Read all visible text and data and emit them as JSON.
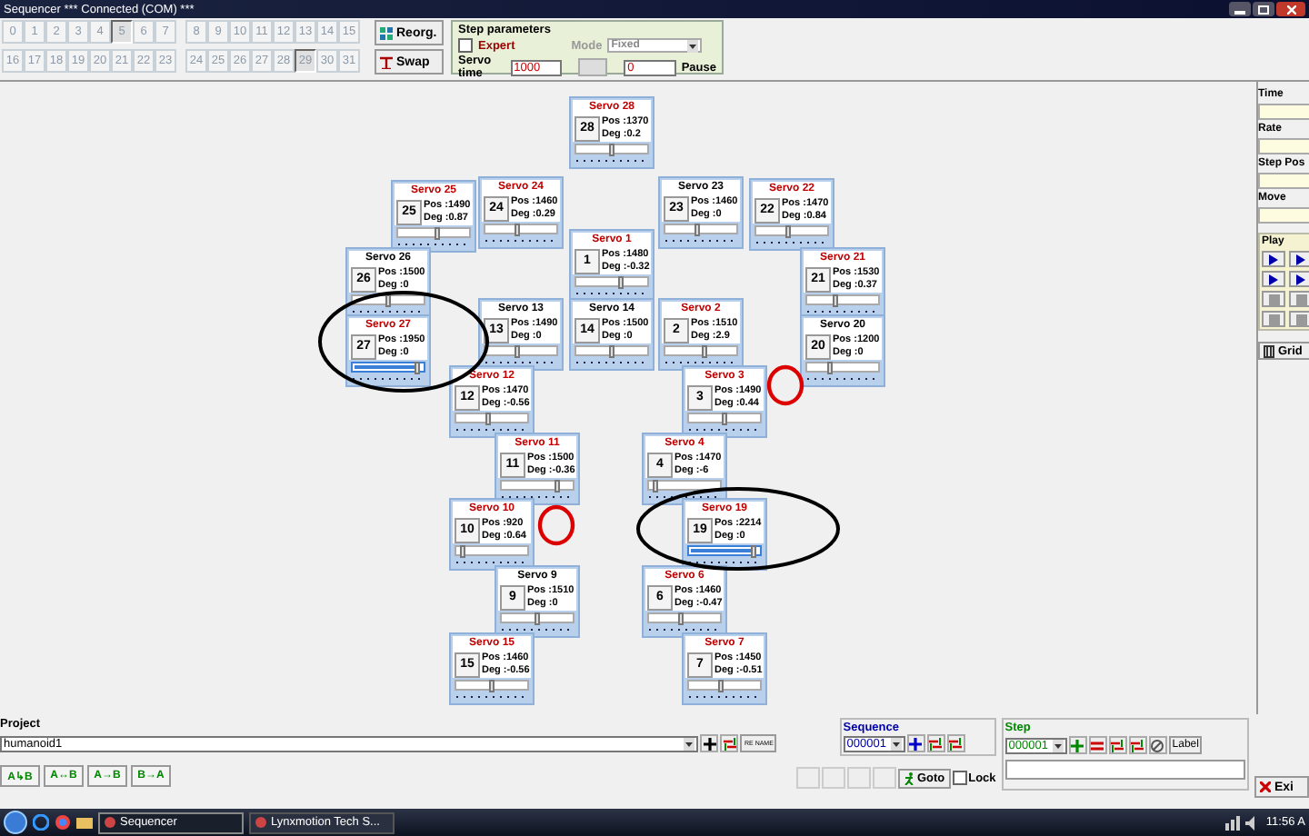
{
  "window": {
    "title": "Sequencer  *** Connected (COM) ***"
  },
  "step_buttons": [
    {
      "label": "0",
      "selected": false
    },
    {
      "label": "1",
      "selected": false
    },
    {
      "label": "2",
      "selected": false
    },
    {
      "label": "3",
      "selected": false
    },
    {
      "label": "4",
      "selected": false
    },
    {
      "label": "5",
      "selected": true
    },
    {
      "label": "6",
      "selected": false
    },
    {
      "label": "7",
      "selected": false
    },
    {
      "label": "8",
      "selected": false
    },
    {
      "label": "9",
      "selected": false
    },
    {
      "label": "10",
      "selected": false
    },
    {
      "label": "11",
      "selected": false
    },
    {
      "label": "12",
      "selected": false
    },
    {
      "label": "13",
      "selected": false
    },
    {
      "label": "14",
      "selected": false
    },
    {
      "label": "15",
      "selected": false
    },
    {
      "label": "16",
      "selected": false
    },
    {
      "label": "17",
      "selected": false
    },
    {
      "label": "18",
      "selected": false
    },
    {
      "label": "19",
      "selected": false
    },
    {
      "label": "20",
      "selected": false
    },
    {
      "label": "21",
      "selected": false
    },
    {
      "label": "22",
      "selected": false
    },
    {
      "label": "23",
      "selected": false
    },
    {
      "label": "24",
      "selected": false
    },
    {
      "label": "25",
      "selected": false
    },
    {
      "label": "26",
      "selected": false
    },
    {
      "label": "27",
      "selected": false
    },
    {
      "label": "28",
      "selected": false
    },
    {
      "label": "29",
      "selected": true
    },
    {
      "label": "30",
      "selected": false
    },
    {
      "label": "31",
      "selected": false
    }
  ],
  "toolbar_buttons": [
    {
      "label": "Reorg."
    },
    {
      "label": "Swap"
    }
  ],
  "step_parameters": {
    "title": "Step parameters",
    "expert": {
      "label": "Expert",
      "checked": false
    },
    "mode": {
      "label": "Mode",
      "value": "Fixed",
      "disabled": true
    },
    "servo_time": {
      "label": "Servo time",
      "value": "1000"
    },
    "pause": {
      "label": "Pause",
      "value": "0"
    }
  },
  "servos": [
    {
      "title": "Servo 28",
      "number": "28",
      "pos": "Pos :1370",
      "deg": "Deg :0.2",
      "color": "#c00000",
      "level": 0.5,
      "selected": false
    },
    {
      "title": "Servo 25",
      "number": "25",
      "pos": "Pos :1490",
      "deg": "Deg :0.87",
      "color": "#c00000",
      "level": 0.55,
      "selected": false
    },
    {
      "title": "Servo 24",
      "number": "24",
      "pos": "Pos :1460",
      "deg": "Deg :0.29",
      "color": "#c00000",
      "level": 0.45,
      "selected": false
    },
    {
      "title": "Servo 23",
      "number": "23",
      "pos": "Pos :1460",
      "deg": "Deg :0",
      "color": "#000000",
      "level": 0.45,
      "selected": false
    },
    {
      "title": "Servo 22",
      "number": "22",
      "pos": "Pos :1470",
      "deg": "Deg :0.84",
      "color": "#c00000",
      "level": 0.45,
      "selected": false
    },
    {
      "title": "Servo 1",
      "number": "1",
      "pos": "Pos :1480",
      "deg": "Deg :-0.32",
      "color": "#c00000",
      "level": 0.65,
      "selected": false
    },
    {
      "title": "Servo 26",
      "number": "26",
      "pos": "Pos :1500",
      "deg": "Deg :0",
      "color": "#000000",
      "level": 0.5,
      "selected": false
    },
    {
      "title": "Servo 21",
      "number": "21",
      "pos": "Pos :1530",
      "deg": "Deg :0.37",
      "color": "#c00000",
      "level": 0.4,
      "selected": false
    },
    {
      "title": "Servo 13",
      "number": "13",
      "pos": "Pos :1490",
      "deg": "Deg :0",
      "color": "#000000",
      "level": 0.45,
      "selected": false
    },
    {
      "title": "Servo 14",
      "number": "14",
      "pos": "Pos :1500",
      "deg": "Deg :0",
      "color": "#000000",
      "level": 0.5,
      "selected": false
    },
    {
      "title": "Servo 2",
      "number": "2",
      "pos": "Pos :1510",
      "deg": "Deg :2.9",
      "color": "#c00000",
      "level": 0.55,
      "selected": false
    },
    {
      "title": "Servo 27",
      "number": "27",
      "pos": "Pos :1950",
      "deg": "Deg :0",
      "color": "#c00000",
      "level": 0.95,
      "selected": true
    },
    {
      "title": "Servo 20",
      "number": "20",
      "pos": "Pos :1200",
      "deg": "Deg :0",
      "color": "#000000",
      "level": 0.3,
      "selected": false
    },
    {
      "title": "Servo 12",
      "number": "12",
      "pos": "Pos :1470",
      "deg": "Deg :-0.56",
      "color": "#c00000",
      "level": 0.45,
      "selected": false
    },
    {
      "title": "Servo 3",
      "number": "3",
      "pos": "Pos :1490",
      "deg": "Deg :0.44",
      "color": "#c00000",
      "level": 0.5,
      "selected": false
    },
    {
      "title": "Servo 11",
      "number": "11",
      "pos": "Pos :1500",
      "deg": "Deg :-0.36",
      "color": "#c00000",
      "level": 0.8,
      "selected": false
    },
    {
      "title": "Servo 4",
      "number": "4",
      "pos": "Pos :1470",
      "deg": "Deg :-6",
      "color": "#c00000",
      "level": 0.05,
      "selected": false
    },
    {
      "title": "Servo 10",
      "number": "10",
      "pos": "Pos :920",
      "deg": "Deg :0.64",
      "color": "#c00000",
      "level": 0.05,
      "selected": false
    },
    {
      "title": "Servo 19",
      "number": "19",
      "pos": "Pos :2214",
      "deg": "Deg :0",
      "color": "#c00000",
      "level": 0.95,
      "selected": true
    },
    {
      "title": "Servo 9",
      "number": "9",
      "pos": "Pos :1510",
      "deg": "Deg :0",
      "color": "#000000",
      "level": 0.5,
      "selected": false
    },
    {
      "title": "Servo 6",
      "number": "6",
      "pos": "Pos :1460",
      "deg": "Deg :-0.47",
      "color": "#c00000",
      "level": 0.45,
      "selected": false
    },
    {
      "title": "Servo 15",
      "number": "15",
      "pos": "Pos :1460",
      "deg": "Deg :-0.56",
      "color": "#c00000",
      "level": 0.5,
      "selected": false
    },
    {
      "title": "Servo 7",
      "number": "7",
      "pos": "Pos :1450",
      "deg": "Deg :-0.51",
      "color": "#c00000",
      "level": 0.45,
      "selected": false
    }
  ],
  "right_panel": {
    "fields": [
      {
        "label": "Time"
      },
      {
        "label": "Rate"
      },
      {
        "label": "Step Pos"
      },
      {
        "label": "Move"
      }
    ],
    "play_title": "Play",
    "grid_button": "Grid"
  },
  "project": {
    "label": "Project",
    "value": "humanoid1",
    "rename_button": "RE NAME"
  },
  "compare_buttons": [
    {
      "label": "A↳B"
    },
    {
      "label": "A↔B"
    },
    {
      "label": "A→B"
    },
    {
      "label": "B→A"
    }
  ],
  "sequence": {
    "label": "Sequence",
    "value": "000001"
  },
  "navigation": {
    "goto_button": "Goto",
    "lock": {
      "label": "Lock",
      "checked": false
    }
  },
  "step": {
    "label": "Step",
    "value": "000001",
    "label_button": "Label"
  },
  "exit_button": "Exi",
  "taskbar": {
    "tasks": [
      {
        "label": "Sequencer",
        "selected": true
      },
      {
        "label": "Lynxmotion Tech S...",
        "selected": false
      }
    ],
    "clock": "11:56 A"
  }
}
